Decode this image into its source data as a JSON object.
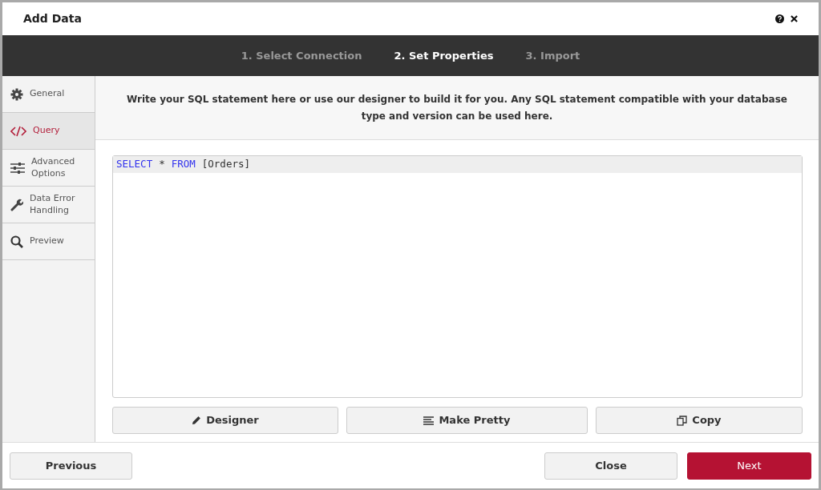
{
  "window": {
    "title": "Add Data"
  },
  "steps": [
    {
      "label": "1. Select Connection",
      "selected": false
    },
    {
      "label": "2. Set Properties",
      "selected": true
    },
    {
      "label": "3. Import",
      "selected": false
    }
  ],
  "sidebar": {
    "items": [
      {
        "label": "General",
        "kind": "gear",
        "selected": false
      },
      {
        "label": "Query",
        "kind": "code",
        "selected": true
      },
      {
        "label": "Advanced Options",
        "kind": "sliders",
        "selected": false
      },
      {
        "label": "Data Error Handling",
        "kind": "wrench",
        "selected": false
      },
      {
        "label": "Preview",
        "kind": "search",
        "selected": false
      }
    ]
  },
  "instructions": "Write your SQL statement here or use our designer to build it for you. Any SQL statement compatible with your database type and version can be used here.",
  "editor": {
    "tokens": [
      {
        "text": "SELECT",
        "kind": "keyword"
      },
      {
        "text": "*",
        "kind": "plain"
      },
      {
        "text": "FROM",
        "kind": "keyword"
      },
      {
        "text": "[Orders]",
        "kind": "plain"
      }
    ]
  },
  "tools": [
    {
      "label": "Designer",
      "kind": "pencil"
    },
    {
      "label": "Make Pretty",
      "kind": "lines"
    },
    {
      "label": "Copy",
      "kind": "copy"
    }
  ],
  "footer": {
    "previous": "Previous",
    "close": "Close",
    "next": "Next"
  }
}
